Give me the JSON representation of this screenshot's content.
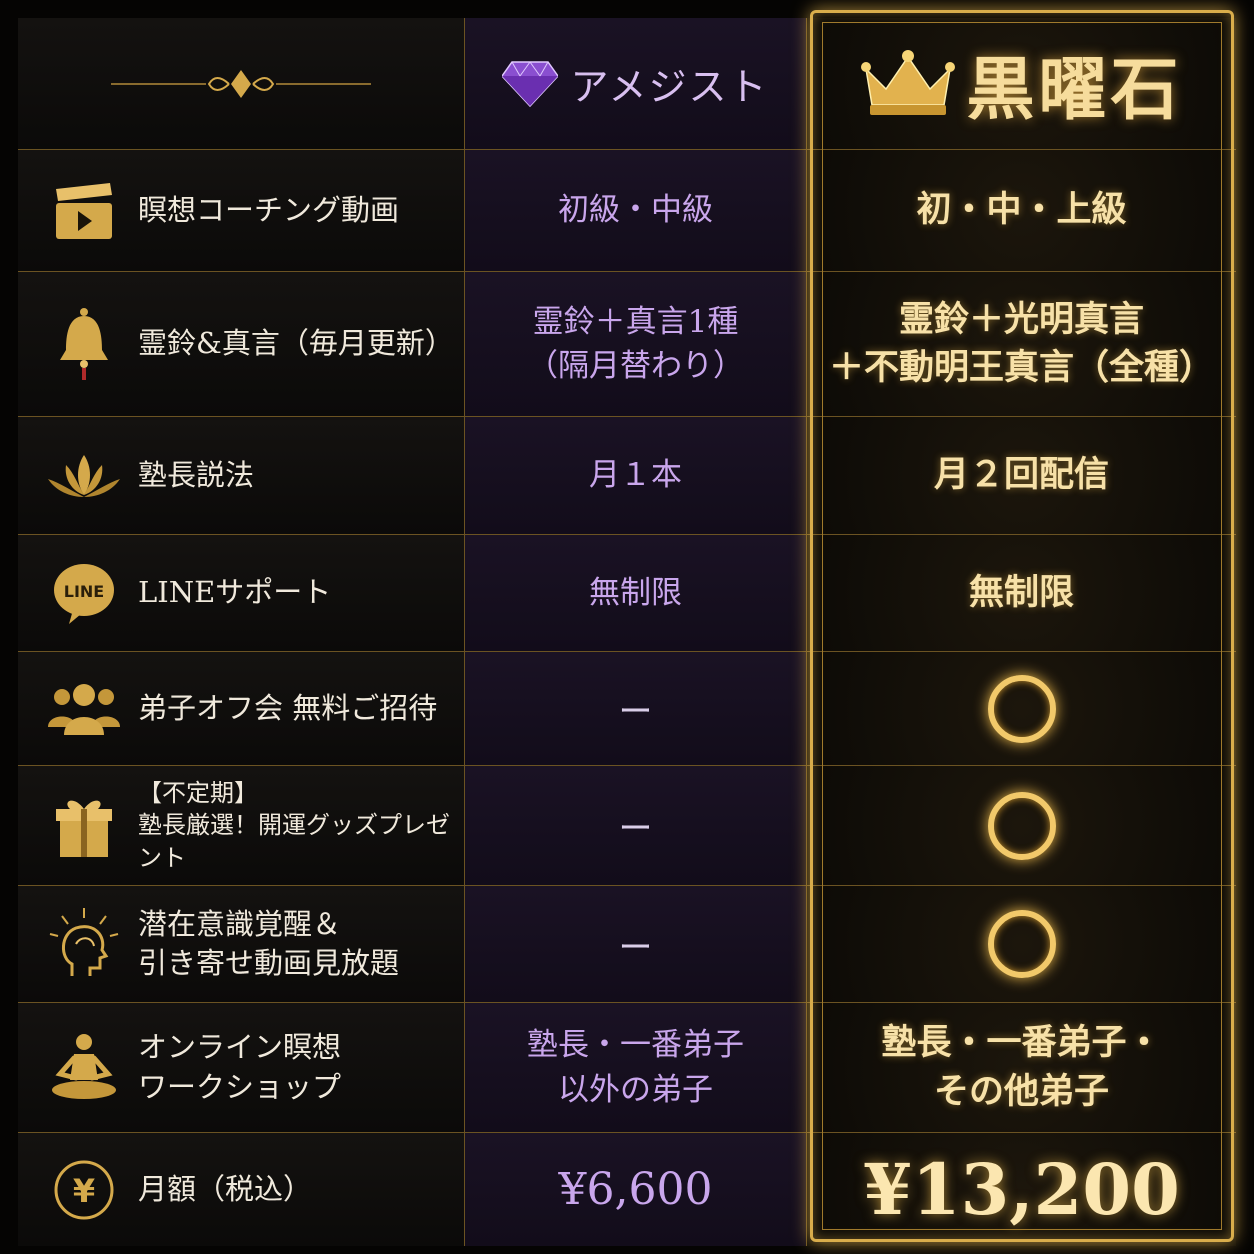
{
  "header": {
    "amethyst_label": "アメジスト",
    "obsidian_label": "黒曜石"
  },
  "rows": [
    {
      "icon": "clapperboard-icon",
      "feature": "瞑想コーチング動画",
      "amethyst": "初級・中級",
      "obsidian": "初・中・上級"
    },
    {
      "icon": "bell-icon",
      "feature": "霊鈴&真言（毎月更新）",
      "amethyst": "霊鈴＋真言1種\n（隔月替わり）",
      "obsidian": "霊鈴＋光明真言\n＋不動明王真言（全種）"
    },
    {
      "icon": "lotus-icon",
      "feature": "塾長説法",
      "amethyst": "月１本",
      "obsidian": "月２回配信"
    },
    {
      "icon": "line-icon",
      "feature": "LINEサポート",
      "amethyst": "無制限",
      "obsidian": "無制限"
    },
    {
      "icon": "people-icon",
      "feature": "弟子オフ会 無料ご招待",
      "amethyst": "ー",
      "obsidian": "〇"
    },
    {
      "icon": "gift-icon",
      "feature": "【不定期】\n塾長厳選！開運グッズプレゼント",
      "amethyst": "ー",
      "obsidian": "〇"
    },
    {
      "icon": "head-icon",
      "feature": "潜在意識覚醒＆\n引き寄せ動画見放題",
      "amethyst": "ー",
      "obsidian": "〇"
    },
    {
      "icon": "meditation-icon",
      "feature": "オンライン瞑想\nワークショップ",
      "amethyst": "塾長・一番弟子\n以外の弟子",
      "obsidian": "塾長・一番弟子・\nその他弟子"
    },
    {
      "icon": "yen-icon",
      "feature": "月額（税込）",
      "amethyst": "¥6,600",
      "obsidian": "¥13,200"
    }
  ],
  "colors": {
    "gold": "#d9ad4b",
    "amethyst": "#c9a6ec",
    "background": "#050403"
  }
}
